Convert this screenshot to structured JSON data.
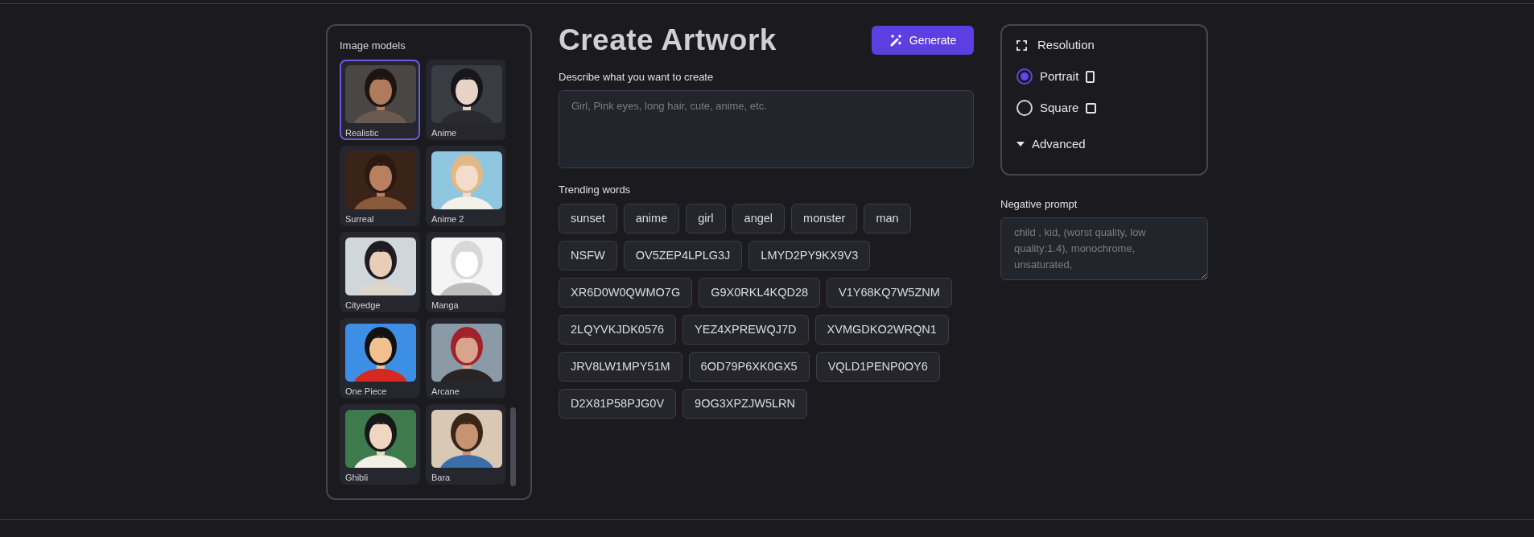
{
  "models": {
    "title": "Image models",
    "items": [
      {
        "label": "Realistic",
        "selected": true
      },
      {
        "label": "Anime",
        "selected": false
      },
      {
        "label": "Surreal",
        "selected": false
      },
      {
        "label": "Anime 2",
        "selected": false
      },
      {
        "label": "Cityedge",
        "selected": false
      },
      {
        "label": "Manga",
        "selected": false
      },
      {
        "label": "One Piece",
        "selected": false
      },
      {
        "label": "Arcane",
        "selected": false
      },
      {
        "label": "Ghibli",
        "selected": false
      },
      {
        "label": "Bara",
        "selected": false
      }
    ]
  },
  "header": {
    "title": "Create Artwork",
    "button": "Generate"
  },
  "prompt": {
    "label": "Describe what you want to create",
    "placeholder": "Girl, Pink eyes, long hair, cute, anime, etc."
  },
  "trending": {
    "label": "Trending words",
    "tags": [
      "sunset",
      "anime",
      "girl",
      "angel",
      "monster",
      "man",
      "NSFW",
      "OV5ZEP4LPLG3J",
      "LMYD2PY9KX9V3",
      "XR6D0W0QWMO7G",
      "G9X0RKL4KQD28",
      "V1Y68KQ7W5ZNM",
      "2LQYVKJDK0576",
      "YEZ4XPREWQJ7D",
      "XVMGDKO2WRQN1",
      "JRV8LW1MPY51M",
      "6OD79P6XK0GX5",
      "VQLD1PENP0OY6",
      "D2X81P58PJG0V",
      "9OG3XPZJW5LRN"
    ]
  },
  "resolution": {
    "title": "Resolution",
    "options": [
      {
        "label": "Portrait",
        "kind": "portrait",
        "selected": true
      },
      {
        "label": "Square",
        "kind": "square",
        "selected": false
      }
    ],
    "advanced": "Advanced"
  },
  "negative": {
    "label": "Negative prompt",
    "placeholder": "child , kid, (worst quality, low quality:1.4), monochrome, unsaturated,"
  }
}
